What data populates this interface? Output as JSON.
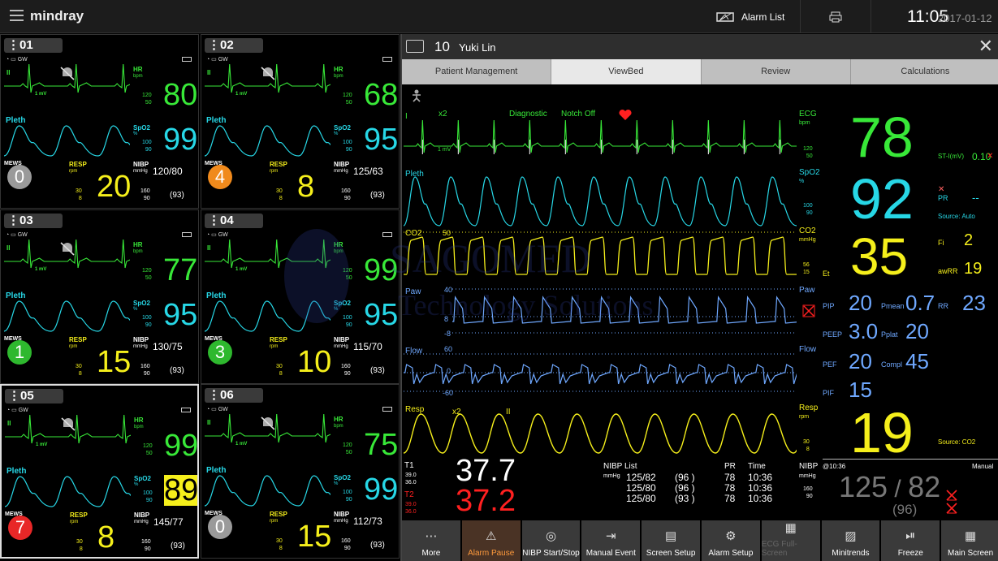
{
  "topbar": {
    "logo": "mindray",
    "alarm_list": "Alarm List",
    "time": "11:05",
    "date": "2017-01-12"
  },
  "beds": [
    {
      "id": "01",
      "hr": "80",
      "spo2": "99",
      "resp": "20",
      "mews": "0",
      "mews_color": "#9a9a9a",
      "nibp": "120/80",
      "map": "(93)",
      "pause": true,
      "sel": false
    },
    {
      "id": "02",
      "hr": "68",
      "spo2": "95",
      "resp": "8",
      "mews": "4",
      "mews_color": "#f08a1c",
      "nibp": "125/63",
      "map": "(93)",
      "pause": true,
      "sel": false
    },
    {
      "id": "03",
      "hr": "77",
      "spo2": "95",
      "resp": "15",
      "mews": "1",
      "mews_color": "#2eb82e",
      "nibp": "130/75",
      "map": "(93)",
      "pause": true,
      "sel": false
    },
    {
      "id": "04",
      "hr": "99",
      "spo2": "95",
      "resp": "10",
      "mews": "3",
      "mews_color": "#2eb82e",
      "nibp": "115/70",
      "map": "(93)",
      "pause": false,
      "sel": false
    },
    {
      "id": "05",
      "hr": "99",
      "spo2": "89",
      "resp": "8",
      "mews": "7",
      "mews_color": "#e82727",
      "nibp": "145/77",
      "map": "(93)",
      "pause": true,
      "sel": true
    },
    {
      "id": "06",
      "hr": "75",
      "spo2": "99",
      "resp": "15",
      "mews": "0",
      "mews_color": "#9a9a9a",
      "nibp": "112/73",
      "map": "(93)",
      "pause": true,
      "sel": false
    }
  ],
  "bedlabels": {
    "lead": "II",
    "gw": "GW",
    "mv": "1 mV",
    "hr": "HR",
    "bpm": "bpm",
    "hr_hi": "120",
    "hr_lo": "50",
    "pleth": "Pleth",
    "spo2": "SpO2",
    "pct": "%",
    "sp_hi": "100",
    "sp_lo": "90",
    "mews": "MEWS",
    "resp": "RESP",
    "rpm": "rpm",
    "rr_hi": "30",
    "rr_lo": "8",
    "nibp": "NIBP",
    "mmhg": "mmHg",
    "nb_hi": "160",
    "nb_lo": "90"
  },
  "main": {
    "bed": "10",
    "name": "Yuki Lin",
    "tabs": [
      "Patient Management",
      "ViewBed",
      "Review",
      "Calculations"
    ],
    "ecg": {
      "lead": "I",
      "gain": "x2",
      "mode": "Diagnostic",
      "notch": "Notch Off",
      "mv": "1 mV",
      "label": "ECG",
      "unit": "bpm",
      "hi": "120",
      "lo": "50",
      "value": "78"
    },
    "pleth": {
      "label": "Pleth",
      "plabel": "SpO2",
      "unit": "%",
      "hi": "100",
      "lo": "90",
      "value": "92"
    },
    "co2": {
      "label": "CO2",
      "scale": "50",
      "plabel": "CO2",
      "unit": "mmHg",
      "hi": "56",
      "lo": "15",
      "value": "35",
      "et": "Et"
    },
    "paw": {
      "label": "Paw",
      "scale_hi": "40",
      "scale_lo": "-8",
      "scale_mid": "8",
      "plabel": "Paw"
    },
    "flow": {
      "label": "Flow",
      "scale_hi": "60",
      "scale_mid": "0",
      "scale_lo": "-60",
      "plabel": "Flow"
    },
    "resp": {
      "label": "Resp",
      "gain": "x2",
      "lead": "II",
      "plabel": "Resp",
      "unit": "rpm",
      "hi": "30",
      "lo": "8",
      "value": "19",
      "source": "Source: CO2"
    },
    "st": {
      "label": "ST-I(mV)",
      "value": "0.10"
    },
    "pr": {
      "label": "PR",
      "value": "--",
      "source": "Source: Auto"
    },
    "fi": {
      "label": "Fi",
      "value": "2"
    },
    "awrr": {
      "label": "awRR",
      "value": "19"
    },
    "vent": {
      "pip_l": "PIP",
      "pip": "20",
      "pmean_l": "Pmean",
      "pmean": "0.7",
      "rr_l": "RR",
      "rr": "23",
      "peep_l": "PEEP",
      "peep": "3.0",
      "pplat_l": "Pplat",
      "pplat": "20",
      "pef_l": "PEF",
      "pef": "20",
      "compl_l": "Compl",
      "compl": "45",
      "pif_l": "PIF",
      "pif": "15"
    },
    "temp": {
      "t1": "T1",
      "t1_hi": "39.0",
      "t1_lo": "36.0",
      "t1_val": "37.7",
      "t2": "T2",
      "t2_hi": "39.0",
      "t2_lo": "36.0",
      "t2_val": "37.2"
    },
    "nibplist": {
      "title": "NIBP List",
      "unit": "mmHg",
      "pr": "PR",
      "time": "Time",
      "rows": [
        {
          "bp": "125/82",
          "map": "(96   )",
          "pr": "78",
          "time": "10:36"
        },
        {
          "bp": "125/80",
          "map": "(96   )",
          "pr": "78",
          "time": "10:36"
        },
        {
          "bp": "125/80",
          "map": "(93   )",
          "pr": "78",
          "time": "10:36"
        }
      ]
    },
    "nibp": {
      "label": "NIBP",
      "unit": "mmHg",
      "hi": "160",
      "lo": "90",
      "at": "@10:36",
      "mode": "Manual",
      "sys": "125",
      "dia": "82",
      "map": "(96)"
    }
  },
  "buttons": [
    {
      "label": "More",
      "icon": "⋯"
    },
    {
      "label": "Alarm Pause",
      "icon": "⚠"
    },
    {
      "label": "NIBP Start/Stop",
      "icon": "◎"
    },
    {
      "label": "Manual Event",
      "icon": "⇥"
    },
    {
      "label": "Screen Setup",
      "icon": "▤"
    },
    {
      "label": "Alarm Setup",
      "icon": "⚙"
    },
    {
      "label": "ECG Full-Screen",
      "icon": "▦"
    },
    {
      "label": "Minitrends",
      "icon": "▨"
    },
    {
      "label": "Freeze",
      "icon": "⏯"
    },
    {
      "label": "Main Screen",
      "icon": "▦"
    }
  ],
  "watermark": {
    "line1": "SAGOMED",
    "line2": "Technology Solutions"
  }
}
